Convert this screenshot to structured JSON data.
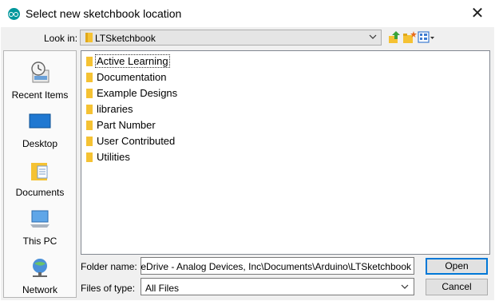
{
  "window": {
    "title": "Select new sketchbook location",
    "close_glyph": "✕",
    "icon": "arduino-icon"
  },
  "look_in": {
    "label": "Look in:",
    "value": "LTSketchbook"
  },
  "toolbar": {
    "buttons": [
      "up-one-level-icon",
      "create-new-folder-icon",
      "view-menu-icon"
    ]
  },
  "places": [
    {
      "label": "Recent Items",
      "icon": "recent-items-icon"
    },
    {
      "label": "Desktop",
      "icon": "desktop-icon"
    },
    {
      "label": "Documents",
      "icon": "documents-icon"
    },
    {
      "label": "This PC",
      "icon": "this-pc-icon"
    },
    {
      "label": "Network",
      "icon": "network-icon"
    }
  ],
  "files": [
    {
      "name": "Active Learning"
    },
    {
      "name": "Documentation"
    },
    {
      "name": "Example Designs"
    },
    {
      "name": "libraries"
    },
    {
      "name": "Part Number"
    },
    {
      "name": "User Contributed"
    },
    {
      "name": "Utilities"
    }
  ],
  "folder_name": {
    "label": "Folder name:",
    "value": ":\\OneDrive - Analog Devices, Inc\\Documents\\Arduino\\LTSketchbook"
  },
  "files_of_type": {
    "label": "Files of type:",
    "value": "All Files"
  },
  "buttons": {
    "open": "Open",
    "cancel": "Cancel"
  },
  "colors": {
    "accent": "#0078d7",
    "folder": "#f5c233",
    "arduino": "#00979c"
  }
}
